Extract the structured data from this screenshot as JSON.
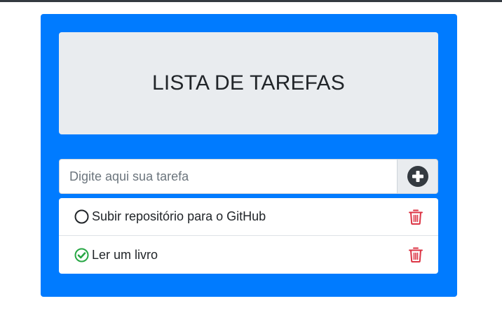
{
  "header": {
    "title": "LISTA DE TAREFAS"
  },
  "form": {
    "placeholder": "Digite aqui sua tarefa",
    "value": "",
    "add_icon": "plus-circle-icon"
  },
  "tasks": [
    {
      "text": "Subir repositório para o GitHub",
      "done": false,
      "status_icon": "circle-outline-icon",
      "delete_icon": "trash-icon"
    },
    {
      "text": "Ler um livro",
      "done": true,
      "status_icon": "check-circle-icon",
      "delete_icon": "trash-icon"
    }
  ],
  "colors": {
    "card_bg": "#007bff",
    "jumbotron_bg": "#e9ecef",
    "done_green": "#28a745",
    "delete_red": "#dc3545",
    "add_icon_dark": "#343a40"
  }
}
